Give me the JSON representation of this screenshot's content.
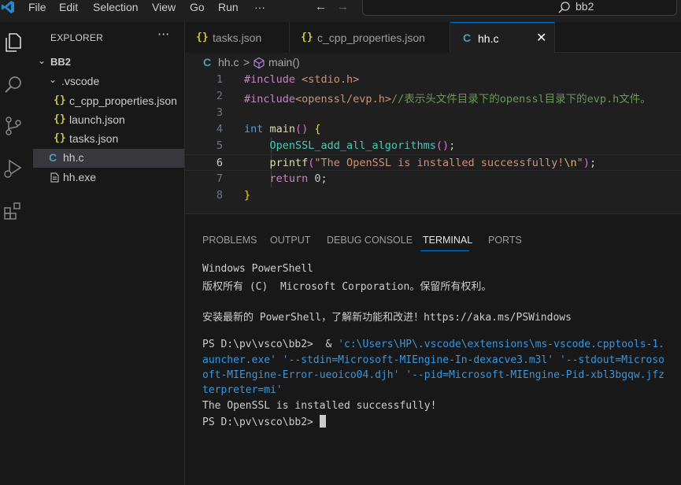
{
  "titlebar": {
    "menu": [
      "File",
      "Edit",
      "Selection",
      "View",
      "Go",
      "Run",
      "···"
    ],
    "search_text": "bb2",
    "back_arrow": "←",
    "forward_arrow": "→"
  },
  "activity_bar": {
    "icons": [
      "explorer-icon",
      "search-icon",
      "source-control-icon",
      "run-debug-icon",
      "extensions-icon"
    ]
  },
  "sidebar": {
    "title": "EXPLORER",
    "more": "···",
    "root": "BB2",
    "vscode_folder": ".vscode",
    "files": [
      {
        "label": "c_cpp_properties.json",
        "type": "json"
      },
      {
        "label": "launch.json",
        "type": "json"
      },
      {
        "label": "tasks.json",
        "type": "json"
      },
      {
        "label": "hh.c",
        "type": "c"
      },
      {
        "label": "hh.exe",
        "type": "exe"
      }
    ]
  },
  "tabs": [
    {
      "label": "tasks.json",
      "type": "json",
      "active": false
    },
    {
      "label": "c_cpp_properties.json",
      "type": "json",
      "active": false
    },
    {
      "label": "hh.c",
      "type": "c",
      "active": true
    }
  ],
  "tab_close": "✕",
  "breadcrumb": {
    "file": "hh.c",
    "separator": ">",
    "symbol": "main()"
  },
  "editor": {
    "line_numbers": [
      "1",
      "2",
      "3",
      "4",
      "5",
      "6",
      "7",
      "8"
    ],
    "current_line": 6,
    "lines": {
      "l1a": "#include ",
      "l1b": "<stdio.h>",
      "l2a": "#include",
      "l2b": "<openssl/evp.h>",
      "l2c": "//表示头文件目录下的openssl目录下的evp.h文件。",
      "l4a": "int",
      "l4b": " main",
      "l4c": "()",
      "l4d": " {",
      "l5a": "    OpenSSL_add_all_algorithms",
      "l5b": "()",
      "l5c": ";",
      "l6a": "    printf",
      "l6b": "(",
      "l6c": "\"The OpenSSL is installed successfully!",
      "l6d": "\\n",
      "l6e": "\"",
      "l6f": ")",
      "l6g": ";",
      "l7a": "    return",
      "l7b": " 0",
      "l7c": ";",
      "l8a": "}"
    }
  },
  "panel": {
    "tabs": [
      "PROBLEMS",
      "OUTPUT",
      "DEBUG CONSOLE",
      "TERMINAL",
      "PORTS"
    ],
    "active_tab": "TERMINAL",
    "terminal": {
      "l1": "Windows PowerShell",
      "l2": "版权所有 (C)  Microsoft Corporation。保留所有权利。",
      "l3": "",
      "l4": "安装最新的 PowerShell，了解新功能和改进！https://aka.ms/PSWindows",
      "l5": "",
      "l6a": "PS D:\\pv\\vsco\\bb2>  & ",
      "l6b": "'c:\\Users\\HP\\.vscode\\extensions\\ms-vscode.cpptools-1.",
      "l7": "auncher.exe' '--stdin=Microsoft-MIEngine-In-dexacve3.m3l' '--stdout=Microso",
      "l8": "oft-MIEngine-Error-ueoico04.djh' '--pid=Microsoft-MIEngine-Pid-xbl3bgqw.jfz",
      "l9": "terpreter=mi'",
      "l10": "The OpenSSL is installed successfully!",
      "l11": "PS D:\\pv\\vsco\\bb2> "
    }
  },
  "colors": {
    "accent": "#0078d4",
    "json_icon": "#cbcb41",
    "c_icon": "#519aba"
  }
}
